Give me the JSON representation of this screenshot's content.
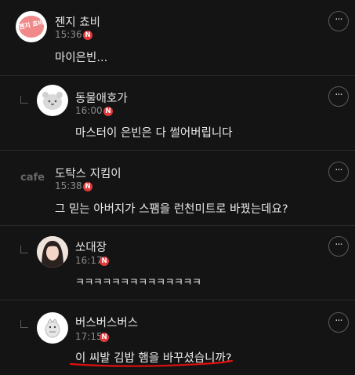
{
  "comments": [
    {
      "author": "젠지 쵸비",
      "time": "15:36",
      "badge": "N",
      "text": "마이은빈...",
      "avatar_text": "젠지 쵸비",
      "is_reply": false
    },
    {
      "author": "동물애호가",
      "time": "16:00",
      "badge": "N",
      "text": "마스터이 은빈은 다 썰어버립니다",
      "is_reply": true
    },
    {
      "author": "도탁스 지킴이",
      "time": "15:38",
      "badge": "N",
      "text": "그 믿는 아버지가 스팸을 런천미트로 바꿨는데요?",
      "avatar_text": "cafe",
      "is_reply": false
    },
    {
      "author": "쏘대장",
      "time": "16:17",
      "badge": "N",
      "text": "ㅋㅋㅋㅋㅋㅋㅋㅋㅋㅋㅋㅋㅋㅋ",
      "is_reply": true
    },
    {
      "author": "버스버스버스",
      "time": "17:15",
      "badge": "N",
      "text": "이 씨발 김밥 햄을 바꾸셨습니까?",
      "is_reply": true
    }
  ],
  "more_label": "···",
  "colors": {
    "background": "#141414",
    "badge": "#e23a3a",
    "underline": "#e01010"
  }
}
